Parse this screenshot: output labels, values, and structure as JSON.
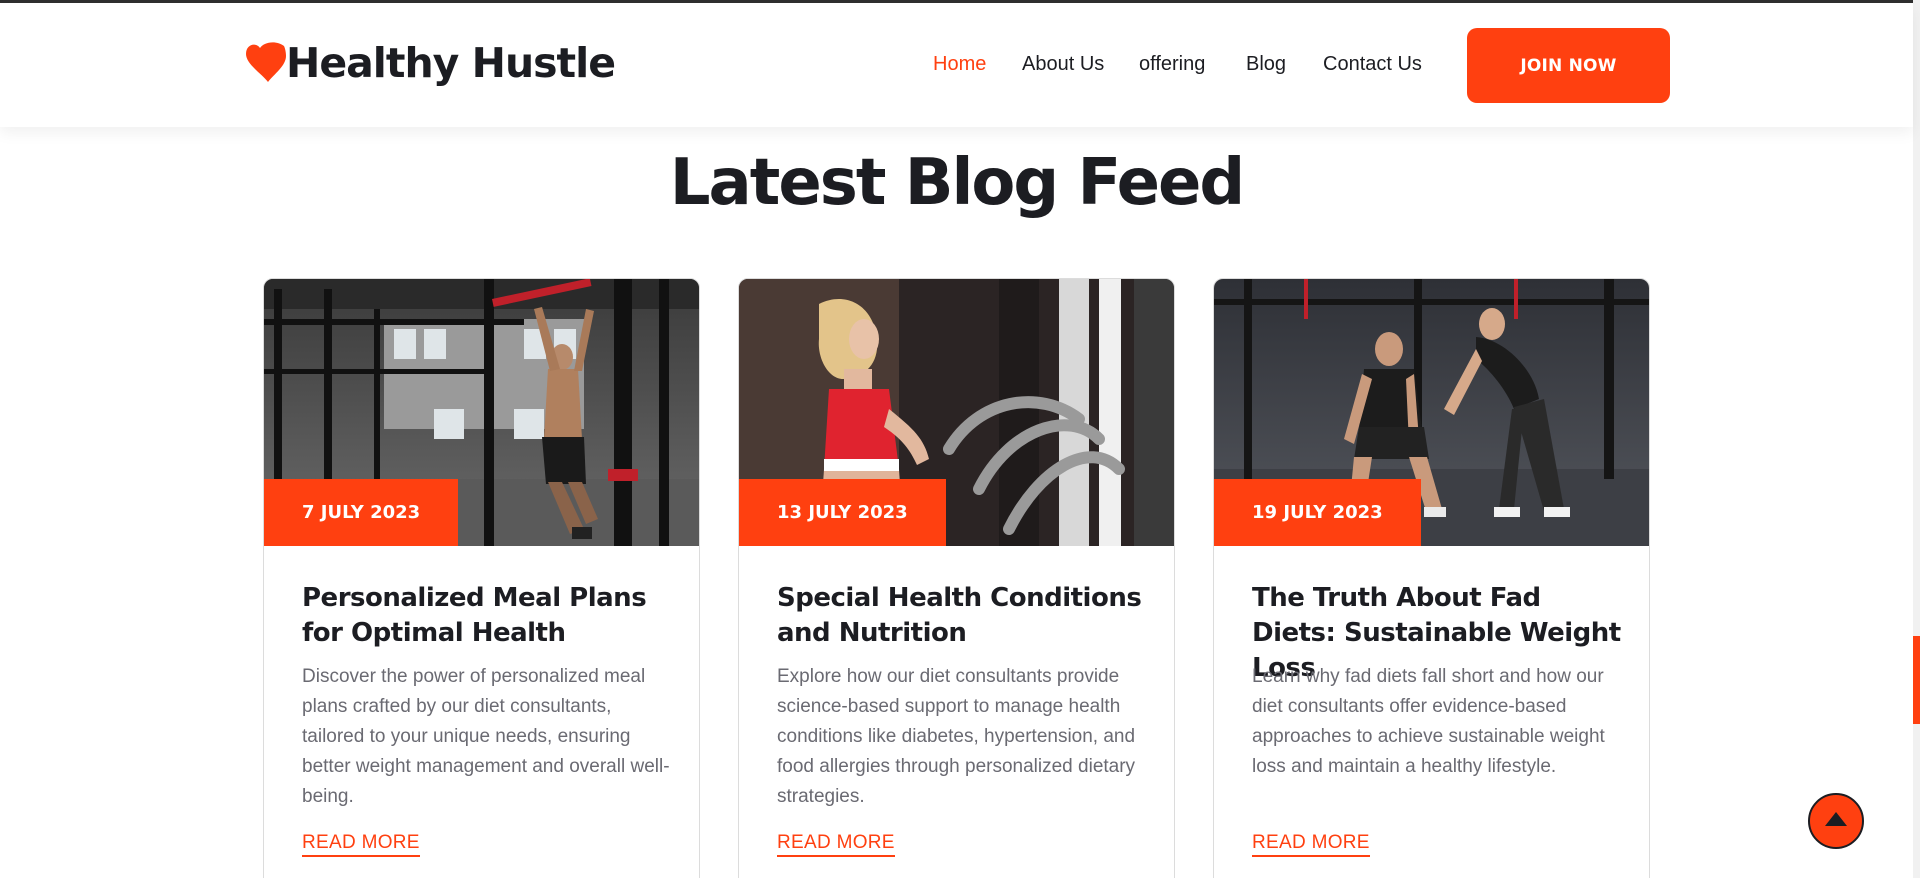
{
  "brand": {
    "name": "Healthy Hustle",
    "accent": "#ff4010",
    "dark": "#1c1d22"
  },
  "nav": {
    "items": [
      {
        "label": "Home",
        "active": true
      },
      {
        "label": "About Us",
        "active": false
      },
      {
        "label": "offering",
        "active": false
      },
      {
        "label": "Blog",
        "active": false
      },
      {
        "label": "Contact Us",
        "active": false
      }
    ],
    "cta_label": "JOIN NOW"
  },
  "section": {
    "title": "Latest Blog Feed"
  },
  "posts": [
    {
      "date": "7 JULY 2023",
      "title": "Personalized Meal Plans for Optimal Health",
      "excerpt": "Discover the power of personalized meal plans crafted by our diet consultants, tailored to your unique needs, ensuring better weight management and overall well-being.",
      "link_label": "READ MORE",
      "image_icon": "gym-pullup-photo"
    },
    {
      "date": "13 JULY 2023",
      "title": "Special Health Conditions and Nutrition",
      "excerpt": "Explore how our diet consultants provide science-based support to manage health conditions like diabetes, hypertension, and food allergies through personalized dietary strategies.",
      "link_label": "READ MORE",
      "image_icon": "treadmill-runner-photo"
    },
    {
      "date": "19 JULY 2023",
      "title": "The Truth About Fad Diets: Sustainable Weight Loss",
      "excerpt": "Learn why fad diets fall short and how our diet consultants offer evidence-based approaches to achieve sustainable weight loss and maintain a healthy lifestyle.",
      "link_label": "READ MORE",
      "image_icon": "kettlebell-training-photo"
    }
  ],
  "back_to_top_icon": "arrow-up-icon"
}
